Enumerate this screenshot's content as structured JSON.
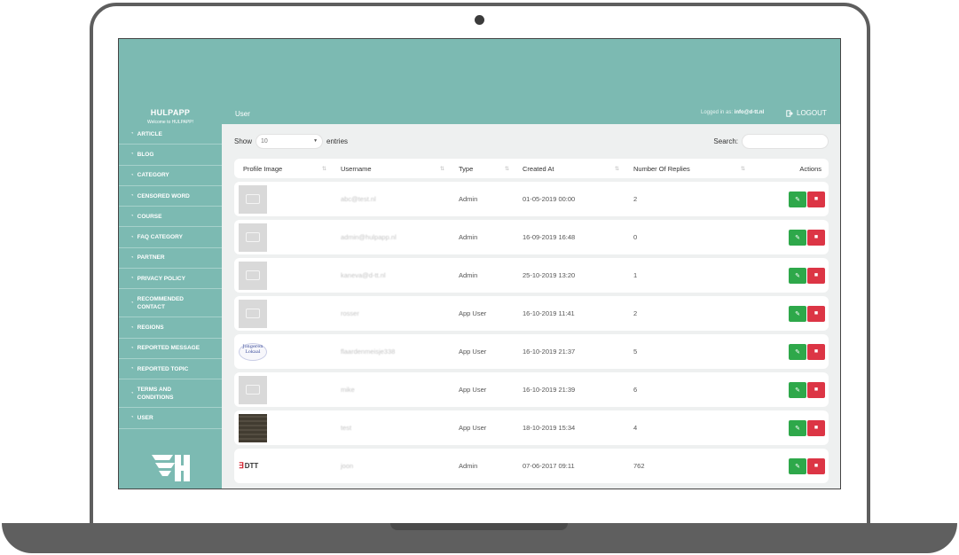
{
  "app": {
    "name": "HULPAPP",
    "welcome": "Welcome to HULPAPP!"
  },
  "header": {
    "page_title": "User",
    "logged_in_label": "Logged in as:",
    "logged_in_email": "info@d-tt.nl",
    "logout_label": "LOGOUT"
  },
  "sidebar": {
    "items": [
      {
        "label": "ARTICLE"
      },
      {
        "label": "BLOG"
      },
      {
        "label": "CATEGORY"
      },
      {
        "label": "CENSORED WORD"
      },
      {
        "label": "COURSE"
      },
      {
        "label": "FAQ CATEGORY"
      },
      {
        "label": "PARTNER"
      },
      {
        "label": "PRIVACY POLICY"
      },
      {
        "label": "RECOMMENDED CONTACT"
      },
      {
        "label": "REGIONS"
      },
      {
        "label": "REPORTED MESSAGE"
      },
      {
        "label": "REPORTED TOPIC"
      },
      {
        "label": "TERMS AND CONDITIONS"
      },
      {
        "label": "USER"
      }
    ]
  },
  "table_controls": {
    "show_label": "Show",
    "entries_value": "10",
    "entries_label": "entries",
    "search_label": "Search:",
    "search_value": ""
  },
  "table": {
    "headers": [
      "Profile Image",
      "Username",
      "Type",
      "Created At",
      "Number Of Replies",
      "Actions"
    ],
    "rows": [
      {
        "avatar": "placeholder-image",
        "username": "abc@test.nl",
        "type": "Admin",
        "created_at": "01-05-2019 00:00",
        "replies": "2"
      },
      {
        "avatar": "placeholder-image",
        "username": "admin@hulpapp.nl",
        "type": "Admin",
        "created_at": "16-09-2019 16:48",
        "replies": "0"
      },
      {
        "avatar": "placeholder-image",
        "username": "kaneva@d-tt.nl",
        "type": "Admin",
        "created_at": "25-10-2019 13:20",
        "replies": "1"
      },
      {
        "avatar": "placeholder-image",
        "username": "rosser",
        "type": "App User",
        "created_at": "16-10-2019 11:41",
        "replies": "2"
      },
      {
        "avatar": "logo-image",
        "username": "flaardenmeisje338",
        "type": "App User",
        "created_at": "16-10-2019 21:37",
        "replies": "5"
      },
      {
        "avatar": "placeholder-image",
        "username": "mike",
        "type": "App User",
        "created_at": "16-10-2019 21:39",
        "replies": "6"
      },
      {
        "avatar": "brick-photo",
        "username": "test",
        "type": "App User",
        "created_at": "18-10-2019 15:34",
        "replies": "4"
      },
      {
        "avatar": "dtt-logo",
        "username": "joon",
        "type": "Admin",
        "created_at": "07-06-2017 09:11",
        "replies": "762"
      }
    ]
  },
  "avatar_texts": {
    "logo_image": "Jongeren Lokaal",
    "dtt_logo": "DTT"
  },
  "colors": {
    "teal": "#7cbab2",
    "edit_green": "#2ea84a",
    "delete_red": "#dc3545",
    "background": "#eef0f0"
  }
}
